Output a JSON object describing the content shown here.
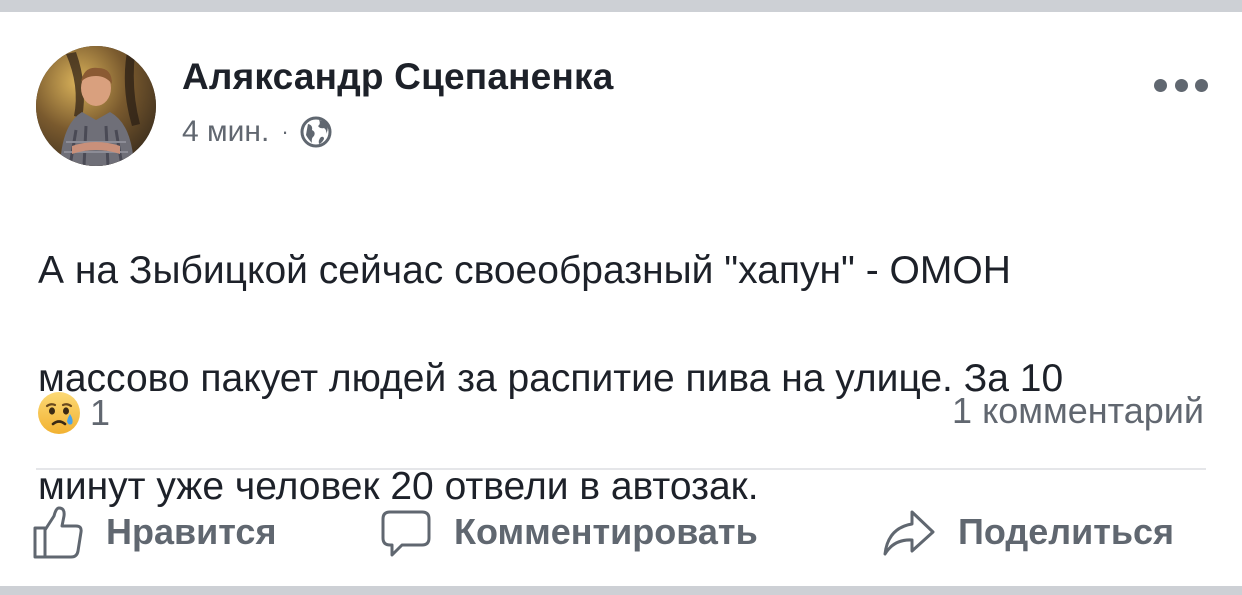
{
  "post": {
    "author": "Аляксандр Сцепаненка",
    "time": "4 мин.",
    "separator": "·",
    "privacy_icon": "globe-icon",
    "more_icon": "more-options-icon",
    "text_lines": [
      "А на Зыбицкой сейчас своеобразный \"хапун\" - ОМОН",
      "массово пакует людей  за распитие пива на улице. За 10",
      "минут уже человек 20 отвели в автозак."
    ]
  },
  "reactions": {
    "emoji_icon": "sad-emoji-icon",
    "count": "1",
    "comments_label": "1 комментарий"
  },
  "actions": {
    "like_label": "Нравится",
    "comment_label": "Комментировать",
    "share_label": "Поделиться"
  },
  "colors": {
    "text_primary": "#1d2129",
    "text_secondary": "#616770",
    "separator_bar": "#cdd0d5",
    "divider": "#e5e6e9",
    "emoji_face": "#f7c23a"
  }
}
